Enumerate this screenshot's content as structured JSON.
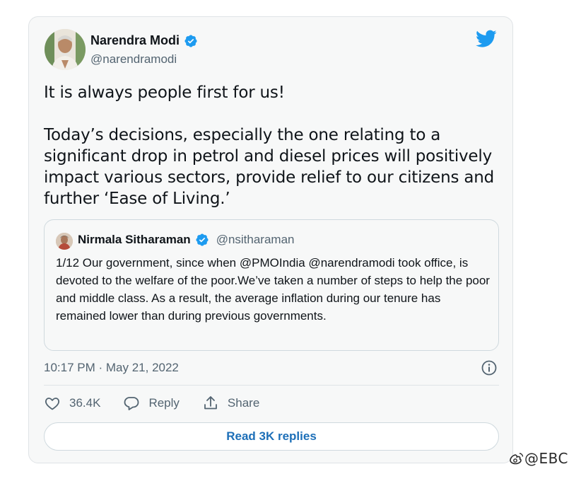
{
  "author": {
    "name": "Narendra Modi",
    "handle": "@narendramodi"
  },
  "tweet": {
    "text": "It is always people first for us!\n\nToday’s decisions, especially the one relating to a significant drop in petrol and diesel prices will positively impact various sectors, provide relief to our citizens and further ‘Ease of Living.’"
  },
  "quote": {
    "name": "Nirmala Sitharaman",
    "handle": "@nsitharaman",
    "text": "1/12  Our government, since when @PMOIndia @narendramodi took office, is\ndevoted to the welfare of the poor.We’ve taken a number of steps to help the poor and middle class. As a result, the average inflation during our tenure has remained lower than during previous governments."
  },
  "timestamp": "10:17 PM · May 21, 2022",
  "actions": {
    "likes": "36.4K",
    "reply": "Reply",
    "share": "Share"
  },
  "replies_button": "Read 3K replies",
  "watermark": "@EBC",
  "colors": {
    "brand_blue": "#1d9bf0",
    "link_blue": "#1d6fb8",
    "secondary_text": "#536471"
  },
  "icons": [
    "twitter-bird-icon",
    "verified-badge-icon",
    "info-icon",
    "heart-icon",
    "reply-bubble-icon",
    "share-icon",
    "weibo-icon"
  ]
}
